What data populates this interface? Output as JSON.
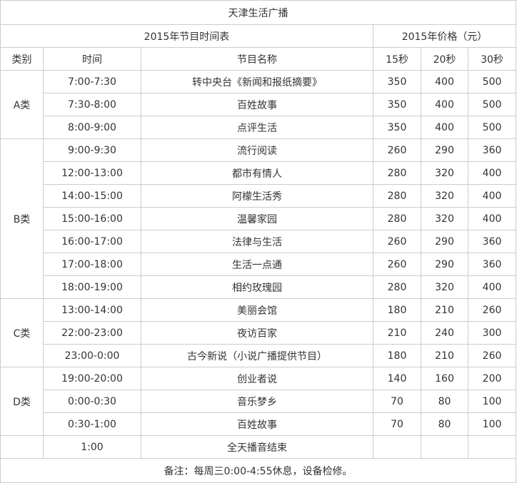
{
  "title": "天津生活广播",
  "schedule_header": "2015年节目时间表",
  "price_header": "2015年价格（元）",
  "columns": {
    "category": "类别",
    "time": "时间",
    "program": "节目名称",
    "p15": "15秒",
    "p20": "20秒",
    "p30": "30秒"
  },
  "groups": [
    {
      "category": "A类",
      "rows": [
        {
          "time": "7:00-7:30",
          "program": "转中央台《新闻和报纸摘要》",
          "p15": "350",
          "p20": "400",
          "p30": "500"
        },
        {
          "time": "7:30-8:00",
          "program": "百姓故事",
          "p15": "350",
          "p20": "400",
          "p30": "500"
        },
        {
          "time": "8:00-9:00",
          "program": "点评生活",
          "p15": "350",
          "p20": "400",
          "p30": "500"
        }
      ]
    },
    {
      "category": "B类",
      "rows": [
        {
          "time": "9:00-9:30",
          "program": "流行阅读",
          "p15": "260",
          "p20": "290",
          "p30": "360"
        },
        {
          "time": "12:00-13:00",
          "program": "都市有情人",
          "p15": "280",
          "p20": "320",
          "p30": "400"
        },
        {
          "time": "14:00-15:00",
          "program": "阿檬生活秀",
          "p15": "280",
          "p20": "320",
          "p30": "400"
        },
        {
          "time": "15:00-16:00",
          "program": "温馨家园",
          "p15": "280",
          "p20": "320",
          "p30": "400"
        },
        {
          "time": "16:00-17:00",
          "program": "法律与生活",
          "p15": "260",
          "p20": "290",
          "p30": "360"
        },
        {
          "time": "17:00-18:00",
          "program": "生活一点通",
          "p15": "260",
          "p20": "290",
          "p30": "360"
        },
        {
          "time": "18:00-19:00",
          "program": "相约玫瑰园",
          "p15": "280",
          "p20": "320",
          "p30": "400"
        }
      ]
    },
    {
      "category": "C类",
      "rows": [
        {
          "time": "13:00-14:00",
          "program": "美丽会馆",
          "p15": "180",
          "p20": "210",
          "p30": "260"
        },
        {
          "time": "22:00-23:00",
          "program": "夜访百家",
          "p15": "210",
          "p20": "240",
          "p30": "300"
        },
        {
          "time": "23:00-0:00",
          "program": "古今新说（小说广播提供节目）",
          "p15": "180",
          "p20": "210",
          "p30": "260"
        }
      ]
    },
    {
      "category": "D类",
      "rows": [
        {
          "time": "19:00-20:00",
          "program": "创业者说",
          "p15": "140",
          "p20": "160",
          "p30": "200"
        },
        {
          "time": "0:00-0:30",
          "program": "音乐梦乡",
          "p15": "70",
          "p20": "80",
          "p30": "100"
        },
        {
          "time": "0:30-1:00",
          "program": "百姓故事",
          "p15": "70",
          "p20": "80",
          "p30": "100"
        }
      ]
    }
  ],
  "end_row": {
    "time": "1:00",
    "program": "全天播音结束"
  },
  "note": "备注：每周三0:00-4:55休息，设备检修。"
}
